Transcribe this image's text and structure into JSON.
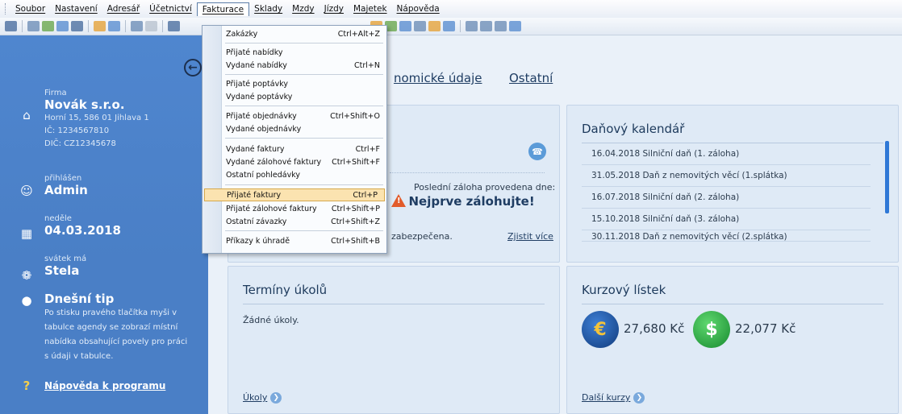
{
  "menubar": {
    "items": [
      "Soubor",
      "Nastavení",
      "Adresář",
      "Účetnictví",
      "Fakturace",
      "Sklady",
      "Mzdy",
      "Jízdy",
      "Majetek",
      "Nápověda"
    ],
    "active": "Fakturace"
  },
  "fakturace_menu": {
    "items": [
      {
        "label": "Zakázky",
        "shortcut": "Ctrl+Alt+Z"
      },
      {
        "label": "Přijaté nabídky",
        "shortcut": ""
      },
      {
        "label": "Vydané nabídky",
        "shortcut": "Ctrl+N"
      },
      {
        "label": "Přijaté poptávky",
        "shortcut": ""
      },
      {
        "label": "Vydané poptávky",
        "shortcut": ""
      },
      {
        "label": "Přijaté objednávky",
        "shortcut": "Ctrl+Shift+O"
      },
      {
        "label": "Vydané objednávky",
        "shortcut": ""
      },
      {
        "label": "Vydané faktury",
        "shortcut": "Ctrl+F"
      },
      {
        "label": "Vydané zálohové faktury",
        "shortcut": "Ctrl+Shift+F"
      },
      {
        "label": "Ostatní pohledávky",
        "shortcut": ""
      },
      {
        "label": "Přijaté faktury",
        "shortcut": "Ctrl+P"
      },
      {
        "label": "Přijaté zálohové faktury",
        "shortcut": "Ctrl+Shift+P"
      },
      {
        "label": "Ostatní závazky",
        "shortcut": "Ctrl+Shift+Z"
      },
      {
        "label": "Příkazy k úhradě",
        "shortcut": "Ctrl+Shift+B"
      }
    ],
    "highlighted": "Přijaté faktury"
  },
  "sidebar": {
    "firm_label": "Firma",
    "firm_name": "Novák s.r.o.",
    "firm_address": "Horní 15, 586 01 Jihlava 1",
    "firm_ic": "IČ: 1234567810",
    "firm_dic": "DIČ: CZ12345678",
    "login_label": "přihlášen",
    "login_user": "Admin",
    "day_label": "neděle",
    "date": "04.03.2018",
    "nameday_label": "svátek má",
    "nameday_name": "Stela",
    "tip_title": "Dnešní tip",
    "tip_text": "Po stisku pravého tlačítka myši v tabulce agendy se zobrazí místní nabídka obsahující povely pro práci s údaji v tabulce.",
    "help_link": "Nápověda k programu"
  },
  "tabs": {
    "economic_partial": "nomické údaje",
    "other": "Ostatní"
  },
  "backup_card": {
    "last_backup_label": "Poslední záloha provedena dne:",
    "warning": "Nejprve zálohujte!",
    "secured_partial": "zabezpečena.",
    "more_link": "Zjistit více"
  },
  "tax_calendar": {
    "title": "Daňový kalendář",
    "rows": [
      "16.04.2018  Silniční daň (1. záloha)",
      "31.05.2018  Daň z nemovitých věcí (1.splátka)",
      "16.07.2018  Silniční daň (2. záloha)",
      "15.10.2018  Silniční daň (3. záloha)",
      "30.11.2018  Daň z nemovitých věcí (2.splátka)"
    ]
  },
  "tasks_card": {
    "title": "Termíny úkolů",
    "empty": "Žádné úkoly.",
    "link": "Úkoly"
  },
  "rates_card": {
    "title": "Kurzový lístek",
    "eur_symbol": "€",
    "eur_rate": "27,680 Kč",
    "usd_symbol": "$",
    "usd_rate": "22,077 Kč",
    "link": "Další kurzy"
  }
}
